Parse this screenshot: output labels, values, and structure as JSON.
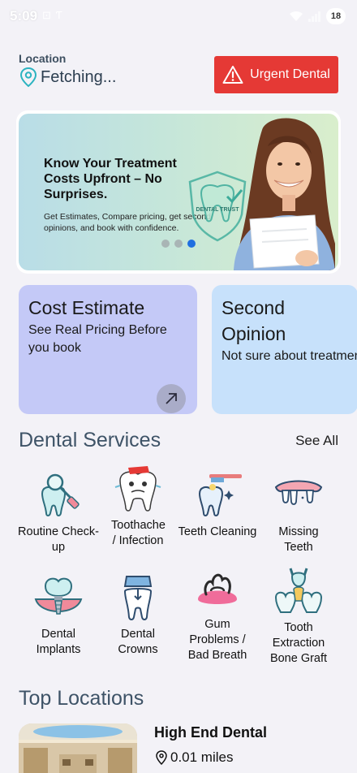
{
  "status_bar": {
    "time": "5:09",
    "battery": "18"
  },
  "header": {
    "location_label": "Location",
    "location_value": "Fetching...",
    "urgent_button": "Urgent Dental"
  },
  "banner": {
    "title": "Know Your Treatment Costs Upfront – No Surprises.",
    "subtitle": "Get Estimates, Compare pricing, get second opinions, and book with confidence.",
    "shield_text": "DENTAL TRUST",
    "active_slide": 3,
    "slide_count": 3
  },
  "cards": [
    {
      "title": "Cost Estimate",
      "desc": "See Real Pricing Before you book",
      "color": "#c4c9f7"
    },
    {
      "title": "Second Opinion",
      "desc": "Not sure about treatment? Let us r",
      "color": "#c7e1fb"
    }
  ],
  "services": {
    "title": "Dental Services",
    "see_all": "See All",
    "items": [
      {
        "label": "Routine Check-up",
        "icon": "magnifier-tooth-icon"
      },
      {
        "label": "Toothache / Infection",
        "icon": "sick-tooth-icon"
      },
      {
        "label": "Teeth Cleaning",
        "icon": "toothbrush-tooth-icon"
      },
      {
        "label": "Missing Teeth",
        "icon": "missing-teeth-icon"
      },
      {
        "label": "Dental Implants",
        "icon": "implant-icon"
      },
      {
        "label": "Dental Crowns",
        "icon": "crown-icon"
      },
      {
        "label": "Gum Problems / Bad Breath",
        "icon": "gum-icon"
      },
      {
        "label": "Tooth Extraction Bone Graft",
        "icon": "extraction-icon"
      }
    ]
  },
  "top_locations": {
    "title": "Top Locations",
    "items": [
      {
        "name": "High End Dental",
        "distance": "0.01 miles"
      }
    ]
  },
  "colors": {
    "urgent": "#e53935",
    "accent_blue": "#1f6fe0",
    "section_title": "#3e5367",
    "icon_teal": "#2f6f7e"
  }
}
